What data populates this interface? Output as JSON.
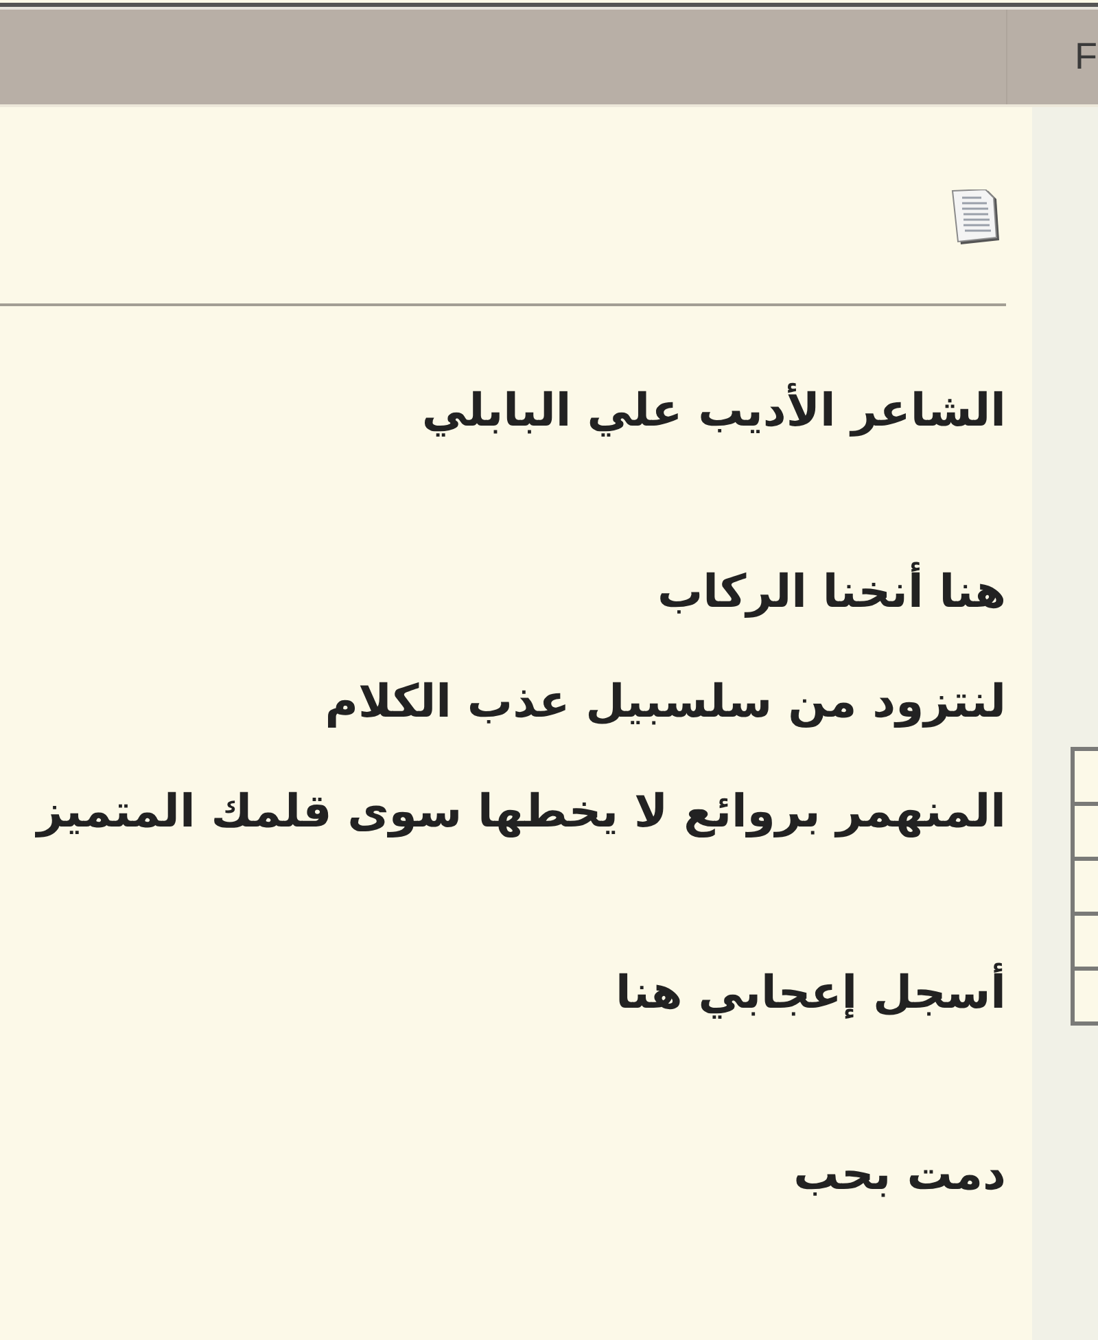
{
  "header": {
    "title": "F"
  },
  "post": {
    "paragraphs": [
      {
        "lines": [
          "الشاعر الأديب علي البابلي"
        ]
      },
      {
        "lines": [
          "هنا أنخنا الركاب",
          "لنتزود من سلسبيل عذب الكلام",
          "المنهمر بروائع لا يخطها سوى قلمك المتميز"
        ]
      },
      {
        "lines": [
          "أسجل إعجابي هنا"
        ]
      },
      {
        "lines": [
          "دمت بحب"
        ]
      }
    ]
  }
}
